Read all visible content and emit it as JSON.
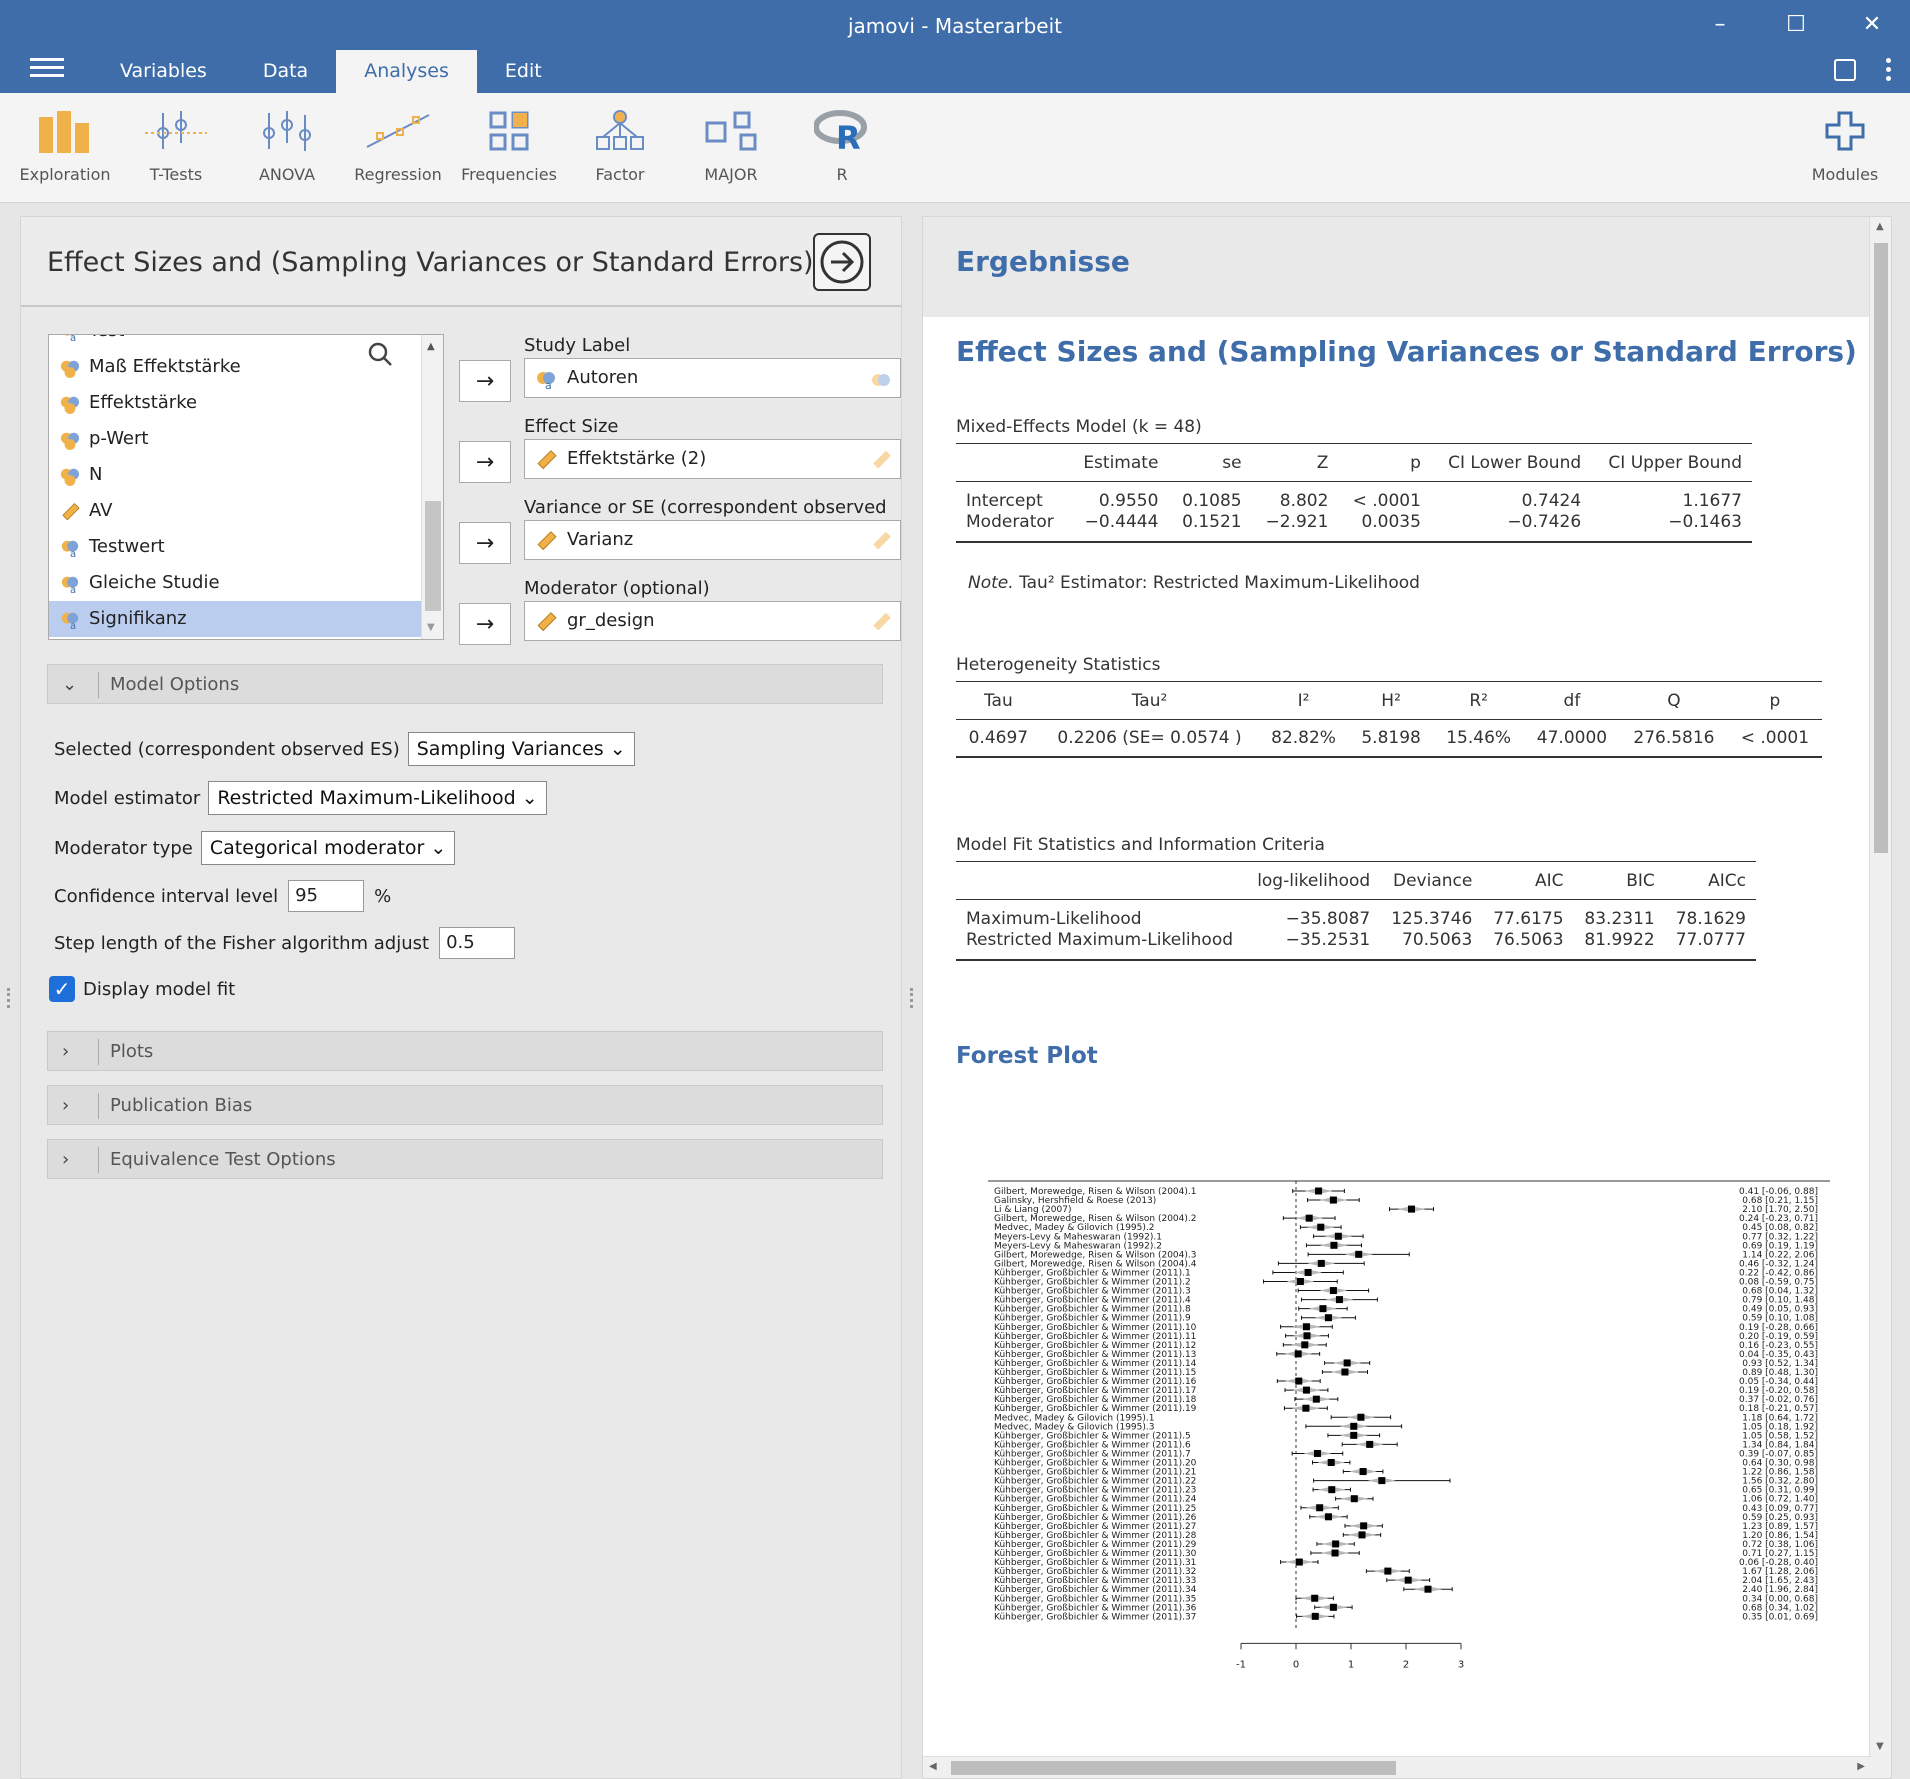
{
  "window": {
    "title": "jamovi - Masterarbeit",
    "minimize": "–",
    "maximize": "☐",
    "close": "✕"
  },
  "tabs": [
    {
      "label": "Variables"
    },
    {
      "label": "Data"
    },
    {
      "label": "Analyses",
      "active": true
    },
    {
      "label": "Edit"
    }
  ],
  "ribbon": {
    "items": [
      "Exploration",
      "T-Tests",
      "ANOVA",
      "Regression",
      "Frequencies",
      "Factor",
      "MAJOR",
      "R"
    ],
    "modules": "Modules"
  },
  "analysis": {
    "title": "Effect Sizes and (Sampling Variances or Standard Errors)",
    "variables": [
      {
        "name": "Test",
        "type": "nominal-text"
      },
      {
        "name": "Maß Effektstärke",
        "type": "nominal"
      },
      {
        "name": "Effektstärke",
        "type": "nominal"
      },
      {
        "name": "p-Wert",
        "type": "nominal"
      },
      {
        "name": "N",
        "type": "nominal"
      },
      {
        "name": "AV",
        "type": "continuous"
      },
      {
        "name": "Testwert",
        "type": "nominal-text"
      },
      {
        "name": "Gleiche Studie",
        "type": "nominal-text"
      },
      {
        "name": "Signifikanz",
        "type": "nominal-text",
        "selected": true
      }
    ],
    "fields": {
      "study_label": {
        "label": "Study Label",
        "value": "Autoren"
      },
      "effect_size": {
        "label": "Effect Size",
        "value": "Effektstärke (2)"
      },
      "variance": {
        "label": "Variance or SE (correspondent observed ES)",
        "value": "Varianz"
      },
      "moderator": {
        "label": "Moderator (optional)",
        "value": "gr_design"
      }
    },
    "arrow": "→",
    "model_options": {
      "header": "Model Options",
      "selected_label": "Selected (correspondent observed ES)",
      "selected_value": "Sampling Variances",
      "estimator_label": "Model estimator",
      "estimator_value": "Restricted Maximum-Likelihood",
      "moderator_type_label": "Moderator type",
      "moderator_type_value": "Categorical moderator",
      "ci_label": "Confidence interval level",
      "ci_value": "95",
      "ci_unit": "%",
      "step_label": "Step length of the Fisher algorithm adjust",
      "step_value": "0.5",
      "display_fit_label": "Display model fit",
      "display_fit_checked": true
    },
    "sections": [
      "Plots",
      "Publication Bias",
      "Equivalence Test Options"
    ]
  },
  "results": {
    "header": "Ergebnisse",
    "title": "Effect Sizes and (Sampling Variances or Standard Errors)",
    "mixed_model": {
      "caption": "Mixed-Effects Model (k = 48)",
      "columns": [
        "",
        "Estimate",
        "se",
        "Z",
        "p",
        "CI Lower Bound",
        "CI Upper Bound"
      ],
      "rows": [
        [
          "Intercept",
          "0.9550",
          "0.1085",
          "8.802",
          "< .0001",
          "0.7424",
          "1.1677"
        ],
        [
          "Moderator",
          "−0.4444",
          "0.1521",
          "−2.921",
          "0.0035",
          "−0.7426",
          "−0.1463"
        ]
      ],
      "note_label": "Note.",
      "note_text": "Tau² Estimator: Restricted Maximum-Likelihood"
    },
    "heterogeneity": {
      "caption": "Heterogeneity Statistics",
      "columns": [
        "Tau",
        "Tau²",
        "I²",
        "H²",
        "R²",
        "df",
        "Q",
        "p"
      ],
      "row": [
        "0.4697",
        "0.2206 (SE= 0.0574 )",
        "82.82%",
        "5.8198",
        "15.46%",
        "47.0000",
        "276.5816",
        "< .0001"
      ]
    },
    "model_fit": {
      "caption": "Model Fit Statistics and Information Criteria",
      "columns": [
        "",
        "log-likelihood",
        "Deviance",
        "AIC",
        "BIC",
        "AICc"
      ],
      "rows": [
        [
          "Maximum-Likelihood",
          "−35.8087",
          "125.3746",
          "77.6175",
          "83.2311",
          "78.1629"
        ],
        [
          "Restricted Maximum-Likelihood",
          "−35.2531",
          "70.5063",
          "76.5063",
          "81.9922",
          "77.0777"
        ]
      ]
    },
    "forest_title": "Forest Plot"
  },
  "chart_data": {
    "type": "scatter",
    "title": "",
    "xlim": [
      -1,
      3
    ],
    "x_ticks": [
      "-1",
      "0",
      "1",
      "2",
      "3"
    ],
    "studies": [
      {
        "label": "Gilbert, Morewedge, Risen & Wilson (2004).1",
        "est": 0.41,
        "lo": -0.06,
        "hi": 0.88,
        "text": "0.41 [-0.06, 0.88]"
      },
      {
        "label": "Galinsky, Hershfield & Roese (2013)",
        "est": 0.68,
        "lo": 0.21,
        "hi": 1.15,
        "text": "0.68 [0.21, 1.15]"
      },
      {
        "label": "Li & Liang (2007)",
        "est": 2.1,
        "lo": 1.7,
        "hi": 2.5,
        "text": "2.10 [1.70, 2.50]"
      },
      {
        "label": "Gilbert, Morewedge, Risen & Wilson (2004).2",
        "est": 0.24,
        "lo": -0.23,
        "hi": 0.71,
        "text": "0.24 [-0.23, 0.71]"
      },
      {
        "label": "Medvec, Madey & Gilovich (1995).2",
        "est": 0.45,
        "lo": 0.08,
        "hi": 0.82,
        "text": "0.45 [0.08, 0.82]"
      },
      {
        "label": "Meyers-Levy & Maheswaran (1992).1",
        "est": 0.77,
        "lo": 0.32,
        "hi": 1.22,
        "text": "0.77 [0.32, 1.22]"
      },
      {
        "label": "Meyers-Levy & Maheswaran (1992).2",
        "est": 0.69,
        "lo": 0.19,
        "hi": 1.19,
        "text": "0.69 [0.19, 1.19]"
      },
      {
        "label": "Gilbert, Morewedge, Risen & Wilson (2004).3",
        "est": 1.14,
        "lo": 0.22,
        "hi": 2.06,
        "text": "1.14 [0.22, 2.06]"
      },
      {
        "label": "Gilbert, Morewedge, Risen & Wilson (2004).4",
        "est": 0.46,
        "lo": -0.32,
        "hi": 1.24,
        "text": "0.46 [-0.32, 1.24]"
      },
      {
        "label": "Kühberger, Großbichler & Wimmer (2011).1",
        "est": 0.22,
        "lo": -0.42,
        "hi": 0.86,
        "text": "0.22 [-0.42, 0.86]"
      },
      {
        "label": "Kühberger, Großbichler & Wimmer (2011).2",
        "est": 0.08,
        "lo": -0.59,
        "hi": 0.75,
        "text": "0.08 [-0.59, 0.75]"
      },
      {
        "label": "Kühberger, Großbichler & Wimmer (2011).3",
        "est": 0.68,
        "lo": 0.04,
        "hi": 1.32,
        "text": "0.68 [0.04, 1.32]"
      },
      {
        "label": "Kühberger, Großbichler & Wimmer (2011).4",
        "est": 0.79,
        "lo": 0.1,
        "hi": 1.48,
        "text": "0.79 [0.10, 1.48]"
      },
      {
        "label": "Kühberger, Großbichler & Wimmer (2011).8",
        "est": 0.49,
        "lo": 0.05,
        "hi": 0.93,
        "text": "0.49 [0.05, 0.93]"
      },
      {
        "label": "Kühberger, Großbichler & Wimmer (2011).9",
        "est": 0.59,
        "lo": 0.1,
        "hi": 1.08,
        "text": "0.59 [0.10, 1.08]"
      },
      {
        "label": "Kühberger, Großbichler & Wimmer (2011).10",
        "est": 0.19,
        "lo": -0.28,
        "hi": 0.66,
        "text": "0.19 [-0.28, 0.66]"
      },
      {
        "label": "Kühberger, Großbichler & Wimmer (2011).11",
        "est": 0.2,
        "lo": -0.19,
        "hi": 0.59,
        "text": "0.20 [-0.19, 0.59]"
      },
      {
        "label": "Kühberger, Großbichler & Wimmer (2011).12",
        "est": 0.16,
        "lo": -0.23,
        "hi": 0.55,
        "text": "0.16 [-0.23, 0.55]"
      },
      {
        "label": "Kühberger, Großbichler & Wimmer (2011).13",
        "est": 0.04,
        "lo": -0.35,
        "hi": 0.43,
        "text": "0.04 [-0.35, 0.43]"
      },
      {
        "label": "Kühberger, Großbichler & Wimmer (2011).14",
        "est": 0.93,
        "lo": 0.52,
        "hi": 1.34,
        "text": "0.93 [0.52, 1.34]"
      },
      {
        "label": "Kühberger, Großbichler & Wimmer (2011).15",
        "est": 0.89,
        "lo": 0.48,
        "hi": 1.3,
        "text": "0.89 [0.48, 1.30]"
      },
      {
        "label": "Kühberger, Großbichler & Wimmer (2011).16",
        "est": 0.05,
        "lo": -0.34,
        "hi": 0.44,
        "text": "0.05 [-0.34, 0.44]"
      },
      {
        "label": "Kühberger, Großbichler & Wimmer (2011).17",
        "est": 0.19,
        "lo": -0.2,
        "hi": 0.58,
        "text": "0.19 [-0.20, 0.58]"
      },
      {
        "label": "Kühberger, Großbichler & Wimmer (2011).18",
        "est": 0.37,
        "lo": -0.02,
        "hi": 0.76,
        "text": "0.37 [-0.02, 0.76]"
      },
      {
        "label": "Kühberger, Großbichler & Wimmer (2011).19",
        "est": 0.18,
        "lo": -0.21,
        "hi": 0.57,
        "text": "0.18 [-0.21, 0.57]"
      },
      {
        "label": "Medvec, Madey & Gilovich (1995).1",
        "est": 1.18,
        "lo": 0.64,
        "hi": 1.72,
        "text": "1.18 [0.64, 1.72]"
      },
      {
        "label": "Medvec, Madey & Gilovich (1995).3",
        "est": 1.05,
        "lo": 0.18,
        "hi": 1.92,
        "text": "1.05 [0.18, 1.92]"
      },
      {
        "label": "Kühberger, Großbichler & Wimmer (2011).5",
        "est": 1.05,
        "lo": 0.58,
        "hi": 1.52,
        "text": "1.05 [0.58, 1.52]"
      },
      {
        "label": "Kühberger, Großbichler & Wimmer (2011).6",
        "est": 1.34,
        "lo": 0.84,
        "hi": 1.84,
        "text": "1.34 [0.84, 1.84]"
      },
      {
        "label": "Kühberger, Großbichler & Wimmer (2011).7",
        "est": 0.39,
        "lo": -0.07,
        "hi": 0.85,
        "text": "0.39 [-0.07, 0.85]"
      },
      {
        "label": "Kühberger, Großbichler & Wimmer (2011).20",
        "est": 0.64,
        "lo": 0.3,
        "hi": 0.98,
        "text": "0.64 [0.30, 0.98]"
      },
      {
        "label": "Kühberger, Großbichler & Wimmer (2011).21",
        "est": 1.22,
        "lo": 0.86,
        "hi": 1.58,
        "text": "1.22 [0.86, 1.58]"
      },
      {
        "label": "Kühberger, Großbichler & Wimmer (2011).22",
        "est": 1.56,
        "lo": 0.32,
        "hi": 2.8,
        "text": "1.56 [0.32, 2.80]"
      },
      {
        "label": "Kühberger, Großbichler & Wimmer (2011).23",
        "est": 0.65,
        "lo": 0.31,
        "hi": 0.99,
        "text": "0.65 [0.31, 0.99]"
      },
      {
        "label": "Kühberger, Großbichler & Wimmer (2011).24",
        "est": 1.06,
        "lo": 0.72,
        "hi": 1.4,
        "text": "1.06 [0.72, 1.40]"
      },
      {
        "label": "Kühberger, Großbichler & Wimmer (2011).25",
        "est": 0.43,
        "lo": 0.09,
        "hi": 0.77,
        "text": "0.43 [0.09, 0.77]"
      },
      {
        "label": "Kühberger, Großbichler & Wimmer (2011).26",
        "est": 0.59,
        "lo": 0.25,
        "hi": 0.93,
        "text": "0.59 [0.25, 0.93]"
      },
      {
        "label": "Kühberger, Großbichler & Wimmer (2011).27",
        "est": 1.23,
        "lo": 0.89,
        "hi": 1.57,
        "text": "1.23 [0.89, 1.57]"
      },
      {
        "label": "Kühberger, Großbichler & Wimmer (2011).28",
        "est": 1.2,
        "lo": 0.86,
        "hi": 1.54,
        "text": "1.20 [0.86, 1.54]"
      },
      {
        "label": "Kühberger, Großbichler & Wimmer (2011).29",
        "est": 0.72,
        "lo": 0.38,
        "hi": 1.06,
        "text": "0.72 [0.38, 1.06]"
      },
      {
        "label": "Kühberger, Großbichler & Wimmer (2011).30",
        "est": 0.71,
        "lo": 0.27,
        "hi": 1.15,
        "text": "0.71 [0.27, 1.15]"
      },
      {
        "label": "Kühberger, Großbichler & Wimmer (2011).31",
        "est": 0.06,
        "lo": -0.28,
        "hi": 0.4,
        "text": "0.06 [-0.28, 0.40]"
      },
      {
        "label": "Kühberger, Großbichler & Wimmer (2011).32",
        "est": 1.67,
        "lo": 1.28,
        "hi": 2.06,
        "text": "1.67 [1.28, 2.06]"
      },
      {
        "label": "Kühberger, Großbichler & Wimmer (2011).33",
        "est": 2.04,
        "lo": 1.65,
        "hi": 2.43,
        "text": "2.04 [1.65, 2.43]"
      },
      {
        "label": "Kühberger, Großbichler & Wimmer (2011).34",
        "est": 2.4,
        "lo": 1.96,
        "hi": 2.84,
        "text": "2.40 [1.96, 2.84]"
      },
      {
        "label": "Kühberger, Großbichler & Wimmer (2011).35",
        "est": 0.34,
        "lo": 0.0,
        "hi": 0.68,
        "text": "0.34 [0.00, 0.68]"
      },
      {
        "label": "Kühberger, Großbichler & Wimmer (2011).36",
        "est": 0.68,
        "lo": 0.34,
        "hi": 1.02,
        "text": "0.68 [0.34, 1.02]"
      },
      {
        "label": "Kühberger, Großbichler & Wimmer (2011).37",
        "est": 0.35,
        "lo": 0.01,
        "hi": 0.69,
        "text": "0.35 [0.01, 0.69]"
      }
    ]
  }
}
